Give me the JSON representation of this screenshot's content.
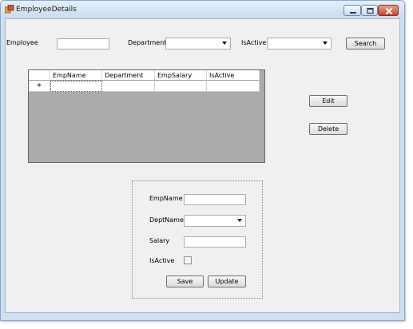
{
  "window": {
    "title": "EmployeeDetails"
  },
  "filters": {
    "employee_label": "Employee",
    "employee_value": "",
    "department_label": "Department",
    "department_value": "",
    "isactive_label": "IsActive",
    "isactive_value": "",
    "search_label": "Search"
  },
  "grid": {
    "columns": [
      "EmpName",
      "Department",
      "EmpSalary",
      "IsActive"
    ],
    "new_row_marker": "*"
  },
  "actions": {
    "edit_label": "Edit",
    "delete_label": "Delete"
  },
  "form": {
    "empname_label": "EmpName",
    "empname_value": "",
    "deptname_label": "DeptName",
    "deptname_value": "",
    "salary_label": "Salary",
    "salary_value": "",
    "isactive_label": "IsActive",
    "isactive_checked": false,
    "save_label": "Save",
    "update_label": "Update"
  },
  "colors": {
    "titlebar": "#c9dbef",
    "client": "#f0f0f0",
    "grid_background": "#ababab",
    "close_button": "#c7432b"
  },
  "icons": {
    "app": "app-icon",
    "minimize": "minimize-icon",
    "maximize": "maximize-icon",
    "close": "close-icon",
    "dropdown": "chevron-down-icon",
    "row_indicator": "asterisk-icon"
  }
}
